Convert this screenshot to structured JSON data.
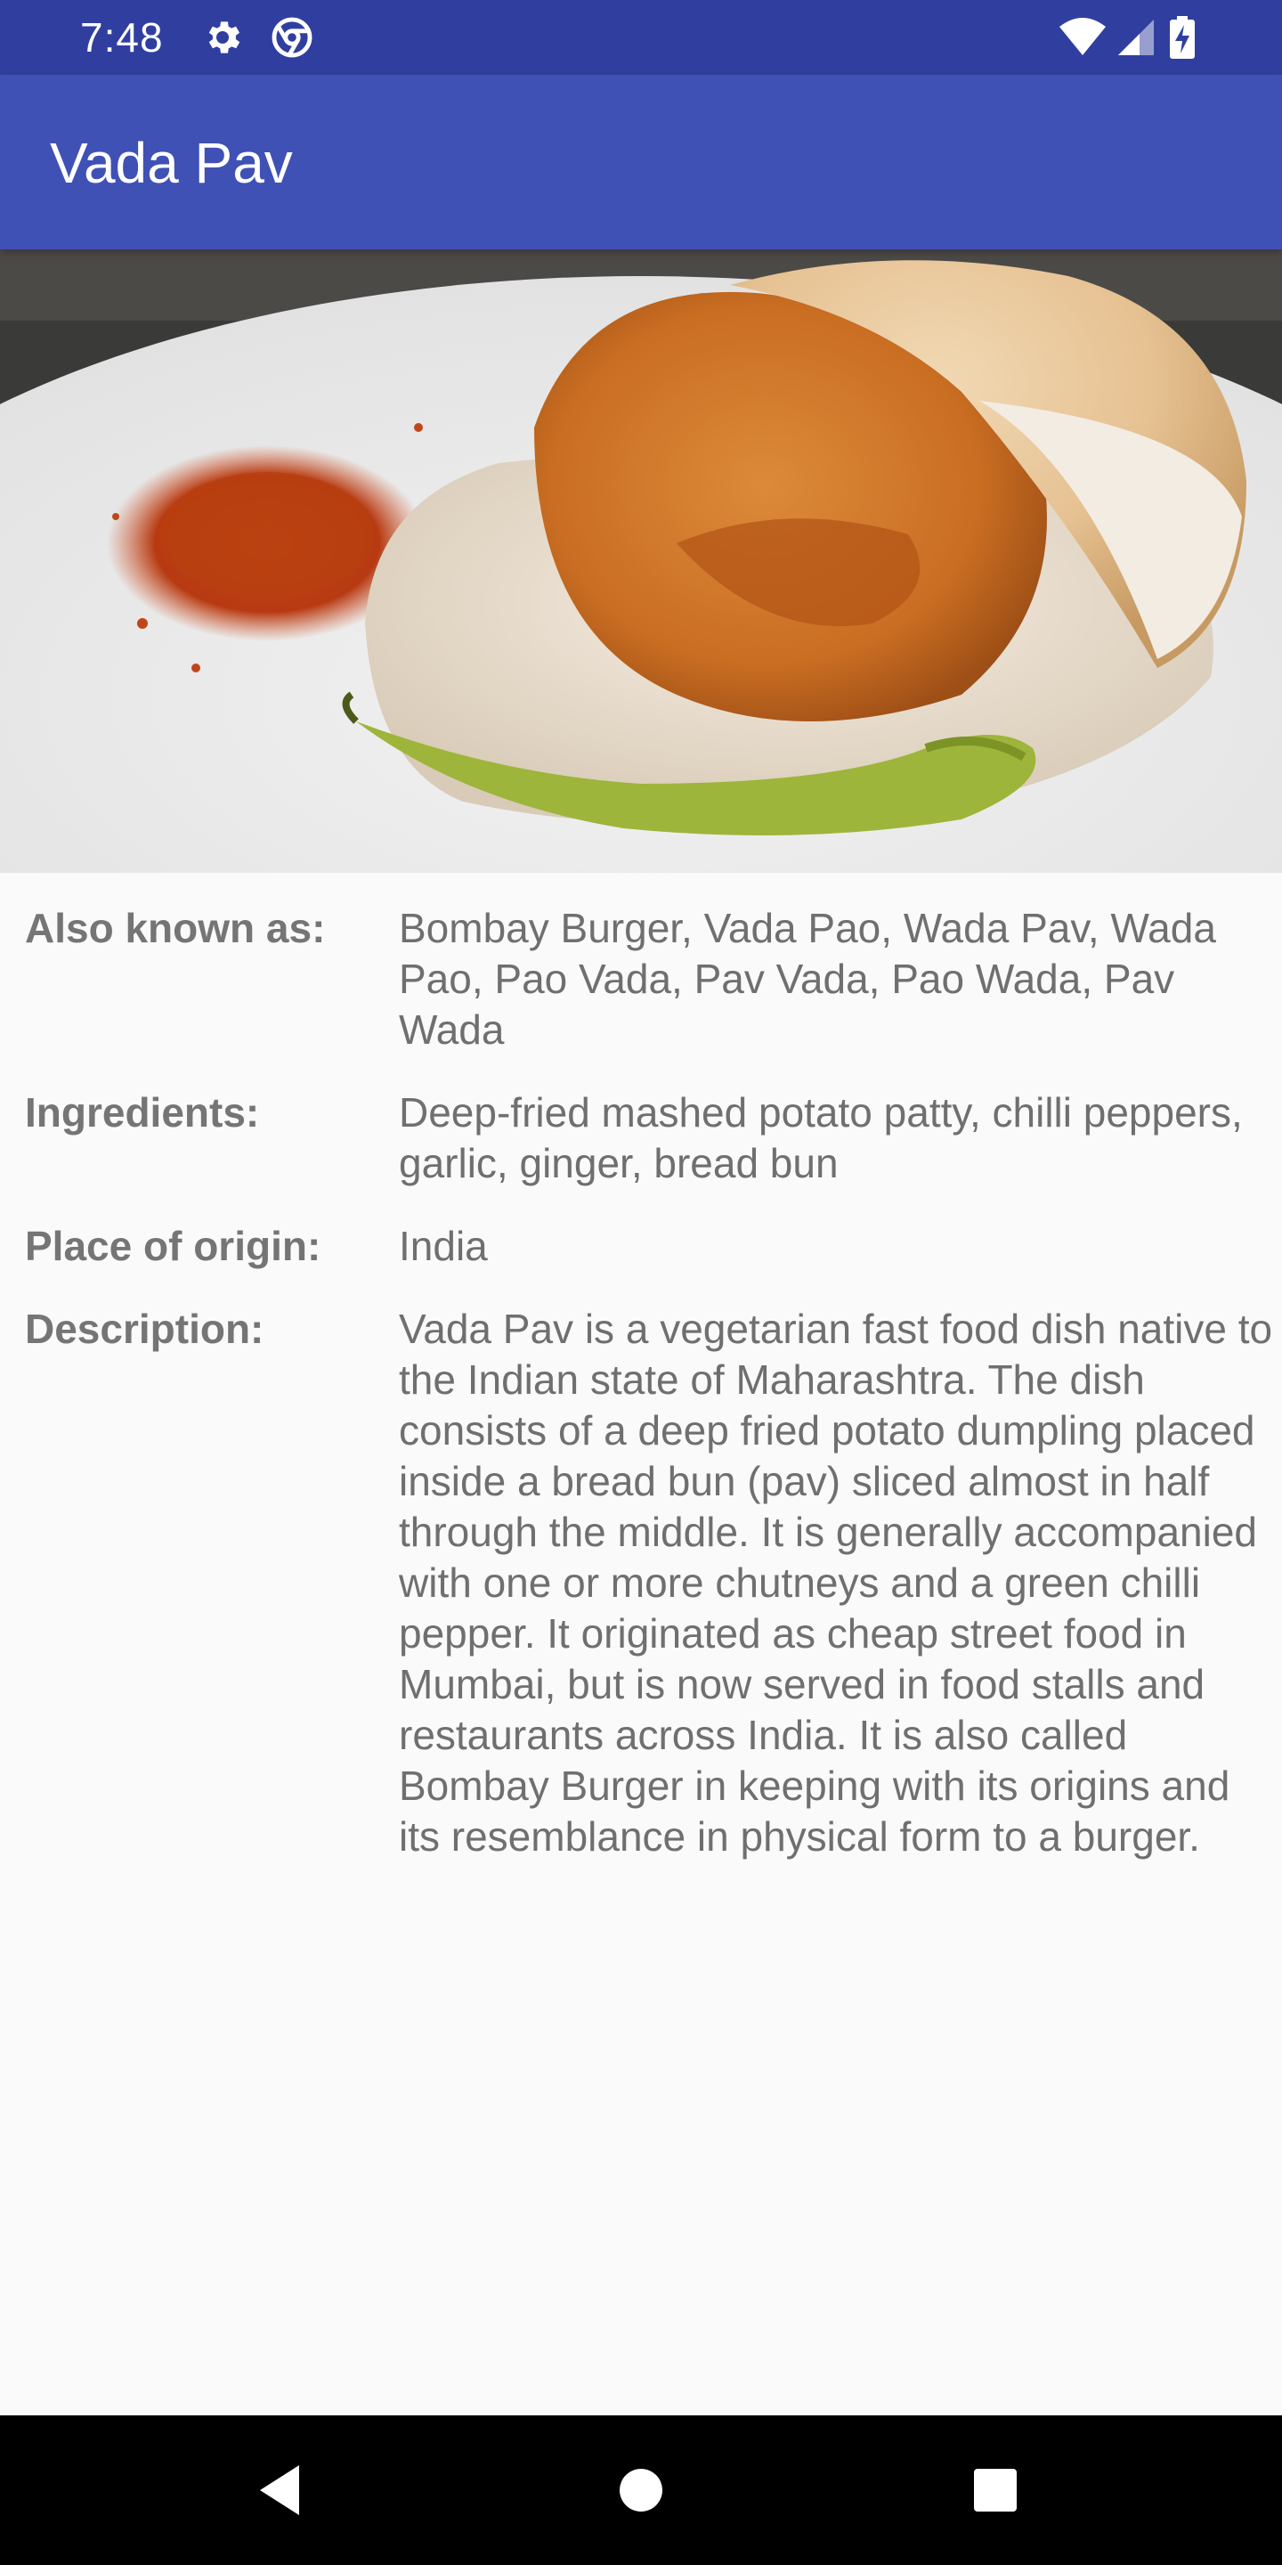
{
  "status_bar": {
    "time": "7:48",
    "icons": [
      "settings-icon",
      "chrome-icon",
      "wifi-icon",
      "signal-icon",
      "battery-charging-icon"
    ]
  },
  "app_bar": {
    "title": "Vada Pav"
  },
  "hero": {
    "subject": "vada-pav-photo"
  },
  "details": {
    "rows": [
      {
        "label": "Also known as:",
        "value": "Bombay Burger, Vada Pao, Wada Pav, Wada Pao, Pao Vada, Pav Vada, Pao Wada, Pav Wada"
      },
      {
        "label": "Ingredients:",
        "value": "Deep-fried mashed potato patty, chilli peppers, garlic, ginger, bread bun"
      },
      {
        "label": "Place of origin:",
        "value": "India"
      },
      {
        "label": "Description:",
        "value": "Vada Pav is a vegetarian fast food dish native to the Indian state of Maharashtra. The dish consists of a deep fried potato dumpling placed inside a bread bun (pav) sliced almost in half through the middle. It is generally accompanied with one or more chutneys and a green chilli pepper. It originated as cheap street food in Mumbai, but is now served in food stalls and restaurants across India. It is also called Bombay Burger in keeping with its origins and its resemblance in physical form to a burger."
      }
    ]
  },
  "nav_bar": {
    "buttons": [
      "back-icon",
      "home-icon",
      "recents-icon"
    ]
  },
  "colors": {
    "status_bar": "#303f9f",
    "app_bar": "#3f51b5",
    "background": "#fafafa",
    "label_text": "#757575",
    "value_text": "#6f6f6f"
  }
}
